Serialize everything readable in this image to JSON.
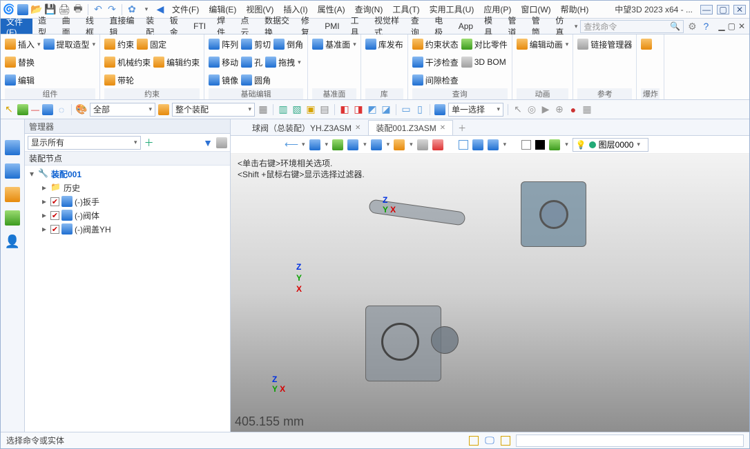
{
  "app": {
    "title": "中望3D 2023 x64 - ...",
    "search_placeholder": "查找命令"
  },
  "menus": [
    "文件(F)",
    "编辑(E)",
    "视图(V)",
    "插入(I)",
    "属性(A)",
    "查询(N)",
    "工具(T)",
    "实用工具(U)",
    "应用(P)",
    "窗口(W)",
    "帮助(H)"
  ],
  "tabs": [
    "文件(F)",
    "造型",
    "曲面",
    "线框",
    "直接编辑",
    "装配",
    "钣金",
    "FTI",
    "焊件",
    "点云",
    "数据交换",
    "修复",
    "PMI",
    "工具",
    "视觉样式",
    "查询",
    "电极",
    "App",
    "模具",
    "管道",
    "管筒",
    "仿真"
  ],
  "ribbon": {
    "g1": {
      "label": "组件",
      "rows": [
        [
          "插入",
          "提取造型"
        ],
        [
          "替换",
          ""
        ],
        [
          "编辑",
          ""
        ]
      ]
    },
    "g2": {
      "label": "约束",
      "rows": [
        [
          "约束",
          "固定"
        ],
        [
          "机械约束",
          "编辑约束"
        ],
        [
          "带轮",
          ""
        ]
      ]
    },
    "g3": {
      "label": "基础编辑",
      "rows": [
        [
          "阵列",
          "剪切",
          "倒角"
        ],
        [
          "移动",
          "孔",
          "拖拽"
        ],
        [
          "镜像",
          "圆角",
          ""
        ]
      ]
    },
    "g4": {
      "label": "基准面",
      "rows": [
        [
          "基准面"
        ]
      ]
    },
    "g5": {
      "label": "库",
      "rows": [
        [
          "库发布"
        ]
      ]
    },
    "g6": {
      "label": "查询",
      "rows": [
        [
          "约束状态",
          "对比零件"
        ],
        [
          "干涉检查",
          "3D BOM"
        ],
        [
          "间隙检查",
          ""
        ]
      ]
    },
    "g7": {
      "label": "动画",
      "rows": [
        [
          "编辑动画"
        ]
      ]
    },
    "g8": {
      "label": "参考",
      "rows": [
        [
          "链接管理器"
        ]
      ]
    },
    "g9": {
      "label": "爆炸"
    }
  },
  "tb2": {
    "combo1": "全部",
    "combo2": "整个装配",
    "combo3": "单一选择"
  },
  "manager": {
    "title": "管理器",
    "show": "显示所有",
    "section": "装配节点",
    "tree": {
      "root": "装配001",
      "items": [
        "历史",
        "(-)扳手",
        "(-)阀体",
        "(-)阀盖YH"
      ]
    }
  },
  "doctabs": [
    {
      "label": "球阀（总装配）YH.Z3ASM",
      "active": false
    },
    {
      "label": "装配001.Z3ASM",
      "active": true
    }
  ],
  "canvas": {
    "hint1": "<单击右键>环境相关选项.",
    "hint2": "<Shift +鼠标右键>显示选择过滤器.",
    "layer": "图层0000",
    "measure": "405.155 mm"
  },
  "status": {
    "msg": "选择命令或实体"
  }
}
